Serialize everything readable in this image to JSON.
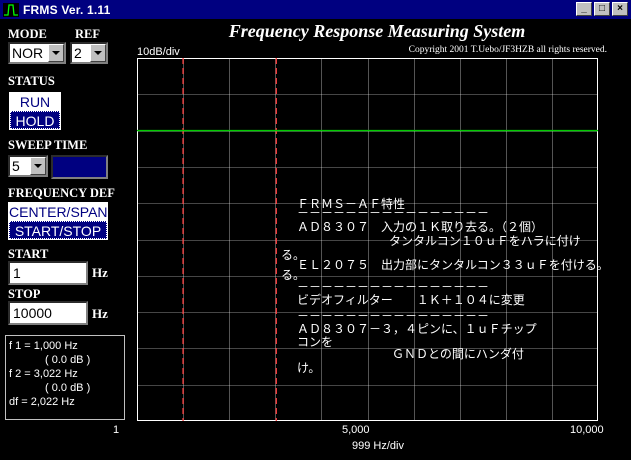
{
  "window": {
    "title": "FRMS  Ver. 1.11",
    "controls": [
      "_",
      "□",
      "×"
    ]
  },
  "header": {
    "title": "Frequency Response Measuring System",
    "copyright": "Copyright 2001 T.Uebo/JF3HZB all rights reserved."
  },
  "left_panel": {
    "mode_label": "MODE",
    "mode_value": "NOR",
    "ref_label": "REF",
    "ref_value": "2",
    "status_label": "STATUS",
    "status_options": [
      "RUN",
      "HOLD"
    ],
    "status_selected": "HOLD",
    "sweep_label": "SWEEP TIME",
    "sweep_value": "5",
    "freqdef_label": "FREQUENCY DEF",
    "freqdef_options": [
      "CENTER/SPAN",
      "START/STOP"
    ],
    "freqdef_selected": "START/STOP",
    "start_label": "START",
    "start_value": "1",
    "start_unit": "Hz",
    "stop_label": "STOP",
    "stop_value": "10000",
    "stop_unit": "Hz",
    "info": {
      "f1": "f 1 = 1,000 Hz",
      "f1_db": "( 0.0 dB )",
      "f2": "f 2 = 3,022 Hz",
      "f2_db": "( 0.0 dB )",
      "df": "df = 2,022 Hz"
    }
  },
  "plot": {
    "y_scale_label": "10dB/div",
    "x_tick_labels": [
      "1",
      "5,000",
      "10,000"
    ],
    "x_axis_label": "999 Hz/div",
    "grid_color": "#ffffff",
    "trace_color": "#00cc00",
    "marker_color": "#ff4040"
  },
  "chart_data": {
    "type": "line",
    "x_range": [
      1,
      10000
    ],
    "x_unit": "Hz",
    "y_scale": "10dB/div",
    "grid": true,
    "x_divisions": 10,
    "y_divisions": 10,
    "series": [
      {
        "x": [
          1,
          10000
        ],
        "y": [
          0,
          0
        ]
      }
    ],
    "markers": [
      {
        "name": "f1",
        "x": 1000,
        "db": 0.0
      },
      {
        "name": "f2",
        "x": 3022,
        "db": 0.0
      }
    ]
  },
  "notes": {
    "line1": "ＦＲＭＳ－ＡＦ特性",
    "sep1": "－－－－－－－－－－－－－－－－",
    "line2": "ＡＤ８３０７　入力の１Ｋ取り去る。（２個）",
    "line3": "タンタルコン１０ｕＦをハラに付け",
    "line4": "る。",
    "line5": "ＥＬ２０７５　出力部にタンタルコン３３ｕＦを付ける。",
    "sep2": "－－－－－－－－－－－－－－－－",
    "line6": "ビデオフィルター　　１Ｋ＋１０４に変更",
    "sep3": "－－－－－－－－－－－－－－－－",
    "line7": "ＡＤ８３０７－３，４ピンに、１ｕＦチップ",
    "line8": "コンを",
    "line9": "ＧＮＤとの間にハンダ付",
    "line10": "け。"
  }
}
